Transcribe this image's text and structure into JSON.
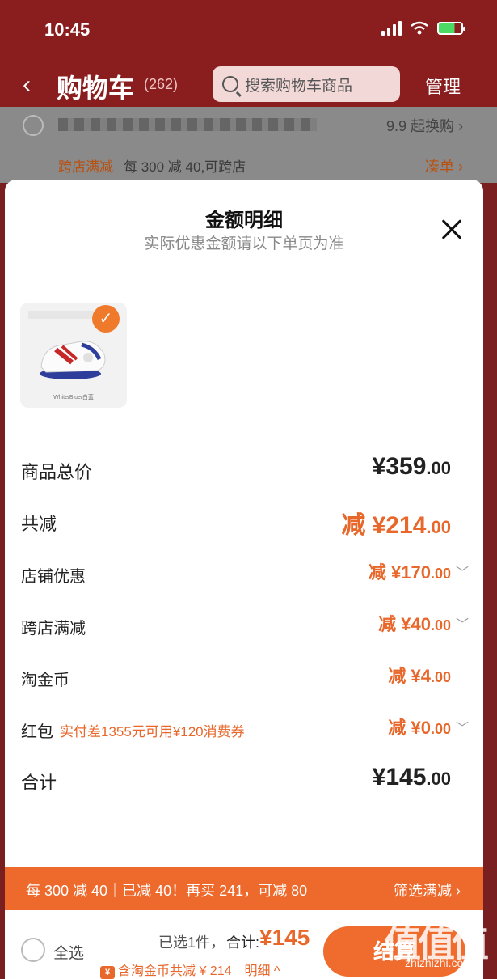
{
  "status_bar": {
    "time": "10:45"
  },
  "header": {
    "back_glyph": "‹",
    "title": "购物车",
    "count": "(262)",
    "search_placeholder": "搜索购物车商品",
    "manage": "管理"
  },
  "background_items": {
    "row1_right": "9.9 起换购 ›",
    "promo_tag": "跨店满减",
    "promo_desc": "每 300 减 40,可跨店",
    "promo_right": "凑单 ›"
  },
  "sheet": {
    "title": "金额明细",
    "subtitle": "实际优惠金额请以下单页为准",
    "product": {
      "caption": "White/Blue/白蓝",
      "selected": true
    }
  },
  "breakdown": {
    "goods_total": {
      "label": "商品总价",
      "yen": "¥359",
      "dec": ".00"
    },
    "total_reduction": {
      "label": "共减",
      "yen": "减 ¥214",
      "dec": ".00"
    },
    "store_discount": {
      "label": "店铺优惠",
      "yen": "减 ¥170",
      "dec": ".00"
    },
    "cross_store": {
      "label": "跨店满减",
      "yen": "减 ¥40",
      "dec": ".00"
    },
    "taojinbi": {
      "label": "淘金币",
      "yen": "减 ¥4",
      "dec": ".00"
    },
    "red_packet": {
      "label": "红包",
      "note": "实付差1355元可用¥120消费券",
      "yen": "减 ¥0",
      "dec": ".00"
    },
    "sum": {
      "label": "合计",
      "yen": "¥145",
      "dec": ".00"
    }
  },
  "promo_bar": {
    "left": "每 300 减 40｜已减 40！再买 241，可减 80",
    "right": "筛选满减 ›"
  },
  "footer": {
    "select_all": "全选",
    "selected_count": "已选1件，",
    "total_label": "合计:",
    "total": "¥145",
    "coin_badge": "¥",
    "coin_text": "含淘金币共减 ¥ 214｜明细 ^",
    "pay_button": "结算"
  },
  "watermark": {
    "main": "值值值",
    "site": "zhizhizhi.com"
  },
  "colors": {
    "accent": "#ed6a2c",
    "header_bg": "#8a1d1d"
  }
}
